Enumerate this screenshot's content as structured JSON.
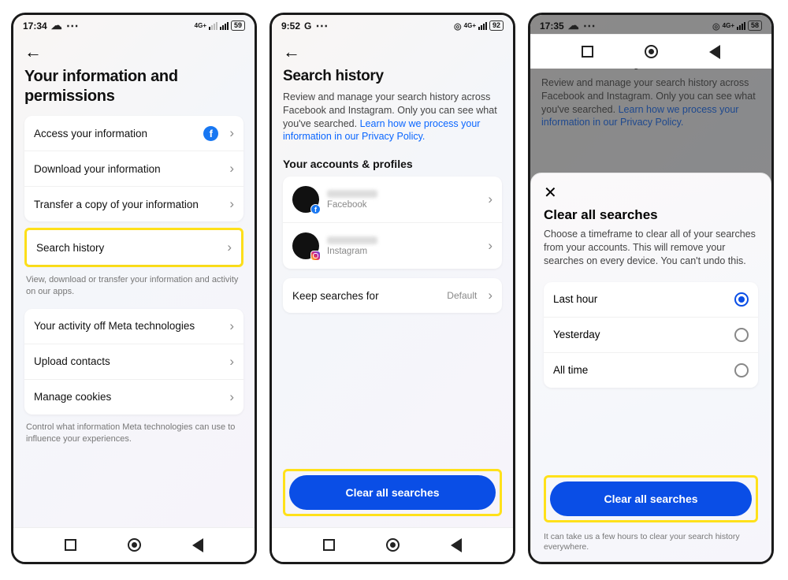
{
  "screen1": {
    "status": {
      "time": "17:34",
      "battery": "59",
      "net": "4G+"
    },
    "title": "Your information and permissions",
    "group1": {
      "items": [
        {
          "label": "Access your information",
          "icon": "facebook"
        },
        {
          "label": "Download your information"
        },
        {
          "label": "Transfer a copy of your information"
        }
      ],
      "highlighted": {
        "label": "Search history"
      },
      "hint": "View, download or transfer your information and activity on our apps."
    },
    "group2": {
      "items": [
        {
          "label": "Your activity off Meta technologies"
        },
        {
          "label": "Upload contacts"
        },
        {
          "label": "Manage cookies"
        }
      ],
      "hint": "Control what information Meta technologies can use to influence your experiences."
    }
  },
  "screen2": {
    "status": {
      "time": "9:52",
      "g": "G",
      "battery": "92",
      "net": "4G+"
    },
    "title": "Search history",
    "desc": "Review and manage your search history across Facebook and Instagram. Only you can see what you've searched. ",
    "link": "Learn how we process your information in our Privacy Policy.",
    "section": "Your accounts & profiles",
    "accounts": [
      {
        "platform": "Facebook",
        "badge": "fb"
      },
      {
        "platform": "Instagram",
        "badge": "ig"
      }
    ],
    "keep": {
      "label": "Keep searches for",
      "value": "Default"
    },
    "cta": "Clear all searches"
  },
  "screen3": {
    "status": {
      "time": "17:35",
      "battery": "58",
      "net": "4G+"
    },
    "bg": {
      "title": "Search history",
      "desc": "Review and manage your search history across Facebook and Instagram. Only you can see what you've searched. ",
      "link": "Learn how we process your information in our Privacy Policy."
    },
    "sheet": {
      "title": "Clear all searches",
      "desc": "Choose a timeframe to clear all of your searches from your accounts. This will remove your searches on every device. You can't undo this.",
      "options": [
        {
          "label": "Last hour",
          "selected": true
        },
        {
          "label": "Yesterday",
          "selected": false
        },
        {
          "label": "All time",
          "selected": false
        }
      ],
      "cta": "Clear all searches",
      "footnote": "It can take us a few hours to clear your search history everywhere."
    }
  }
}
